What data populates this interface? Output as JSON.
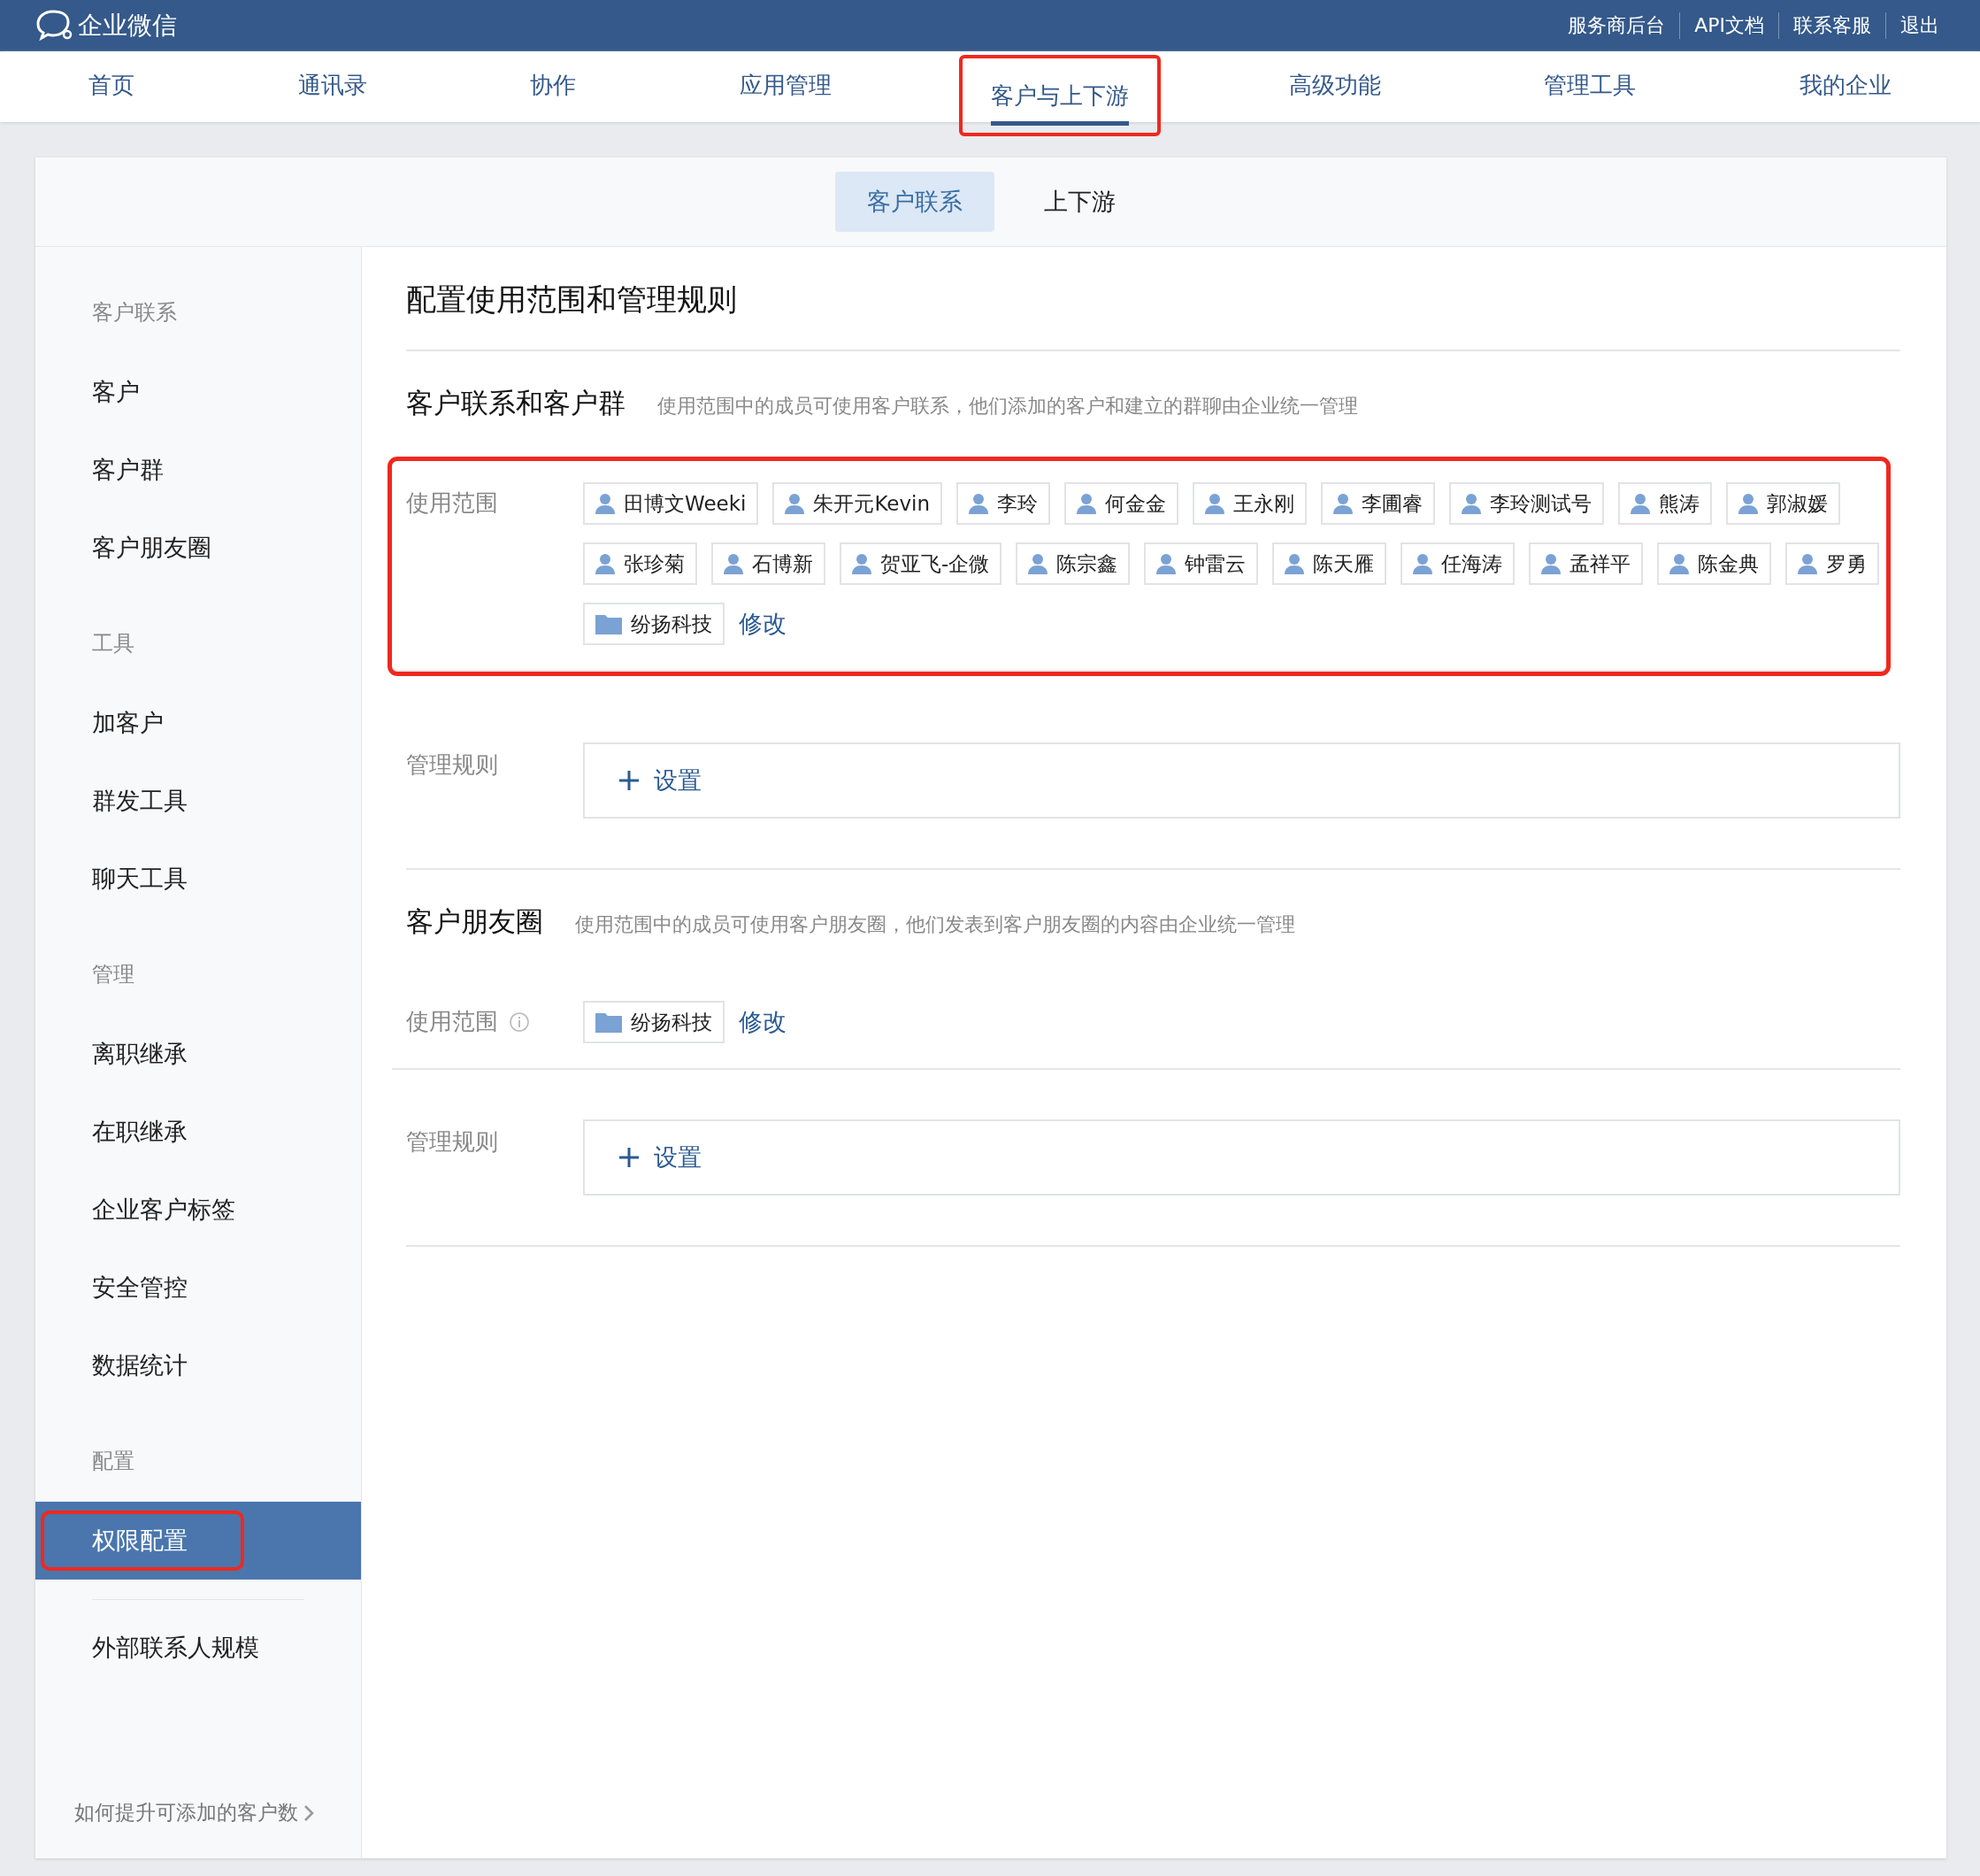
{
  "header": {
    "logo": "企业微信",
    "links": [
      "服务商后台",
      "API文档",
      "联系客服",
      "退出"
    ]
  },
  "nav": [
    {
      "label": "首页",
      "selected": false,
      "highlighted": false
    },
    {
      "label": "通讯录",
      "selected": false,
      "highlighted": false
    },
    {
      "label": "协作",
      "selected": false,
      "highlighted": false
    },
    {
      "label": "应用管理",
      "selected": false,
      "highlighted": false
    },
    {
      "label": "客户与上下游",
      "selected": true,
      "highlighted": true
    },
    {
      "label": "高级功能",
      "selected": false,
      "highlighted": false
    },
    {
      "label": "管理工具",
      "selected": false,
      "highlighted": false
    },
    {
      "label": "我的企业",
      "selected": false,
      "highlighted": false
    }
  ],
  "subtabs": [
    {
      "label": "客户联系",
      "selected": true
    },
    {
      "label": "上下游",
      "selected": false
    }
  ],
  "sidebar": {
    "groups": [
      {
        "heading": "客户联系",
        "items": [
          {
            "label": "客户",
            "selected": false,
            "highlighted": false
          },
          {
            "label": "客户群",
            "selected": false,
            "highlighted": false
          },
          {
            "label": "客户朋友圈",
            "selected": false,
            "highlighted": false
          }
        ]
      },
      {
        "heading": "工具",
        "items": [
          {
            "label": "加客户",
            "selected": false,
            "highlighted": false
          },
          {
            "label": "群发工具",
            "selected": false,
            "highlighted": false
          },
          {
            "label": "聊天工具",
            "selected": false,
            "highlighted": false
          }
        ]
      },
      {
        "heading": "管理",
        "items": [
          {
            "label": "离职继承",
            "selected": false,
            "highlighted": false
          },
          {
            "label": "在职继承",
            "selected": false,
            "highlighted": false
          },
          {
            "label": "企业客户标签",
            "selected": false,
            "highlighted": false
          },
          {
            "label": "安全管控",
            "selected": false,
            "highlighted": false
          },
          {
            "label": "数据统计",
            "selected": false,
            "highlighted": false
          }
        ]
      },
      {
        "heading": "配置",
        "items": [
          {
            "label": "权限配置",
            "selected": true,
            "highlighted": true
          }
        ]
      },
      {
        "items": [
          {
            "label": "外部联系人规模",
            "selected": false,
            "highlighted": false
          }
        ]
      }
    ],
    "footer_link": "如何提升可添加的客户数"
  },
  "content": {
    "title": "配置使用范围和管理规则",
    "sections": [
      {
        "heading": "客户联系和客户群",
        "description": "使用范围中的成员可使用客户联系，他们添加的客户和建立的群聊由企业统一管理",
        "scope": {
          "label": "使用范围",
          "info_icon": false,
          "highlighted": true,
          "edit_link": "修改",
          "members": [
            {
              "kind": "person",
              "name": "田博文Weeki"
            },
            {
              "kind": "person",
              "name": "朱开元Kevin"
            },
            {
              "kind": "person",
              "name": "李玲"
            },
            {
              "kind": "person",
              "name": "何金金"
            },
            {
              "kind": "person",
              "name": "王永刚"
            },
            {
              "kind": "person",
              "name": "李圃睿"
            },
            {
              "kind": "person",
              "name": "李玲测试号"
            },
            {
              "kind": "person",
              "name": "熊涛"
            },
            {
              "kind": "person",
              "name": "郭淑媛"
            },
            {
              "kind": "person",
              "name": "张珍菊"
            },
            {
              "kind": "person",
              "name": "石博新"
            },
            {
              "kind": "person",
              "name": "贺亚飞-企微"
            },
            {
              "kind": "person",
              "name": "陈宗鑫"
            },
            {
              "kind": "person",
              "name": "钟雷云"
            },
            {
              "kind": "person",
              "name": "陈天雁"
            },
            {
              "kind": "person",
              "name": "任海涛"
            },
            {
              "kind": "person",
              "name": "孟祥平"
            },
            {
              "kind": "person",
              "name": "陈金典"
            },
            {
              "kind": "person",
              "name": "罗勇"
            },
            {
              "kind": "department",
              "name": "纷扬科技"
            }
          ]
        },
        "rules": {
          "label": "管理规则",
          "button": "设置"
        }
      },
      {
        "heading": "客户朋友圈",
        "description": "使用范围中的成员可使用客户朋友圈，他们发表到客户朋友圈的内容由企业统一管理",
        "scope": {
          "label": "使用范围",
          "info_icon": true,
          "highlighted": false,
          "edit_link": "修改",
          "members": [
            {
              "kind": "department",
              "name": "纷扬科技"
            }
          ]
        },
        "rules": {
          "label": "管理规则",
          "button": "设置"
        }
      }
    ]
  }
}
